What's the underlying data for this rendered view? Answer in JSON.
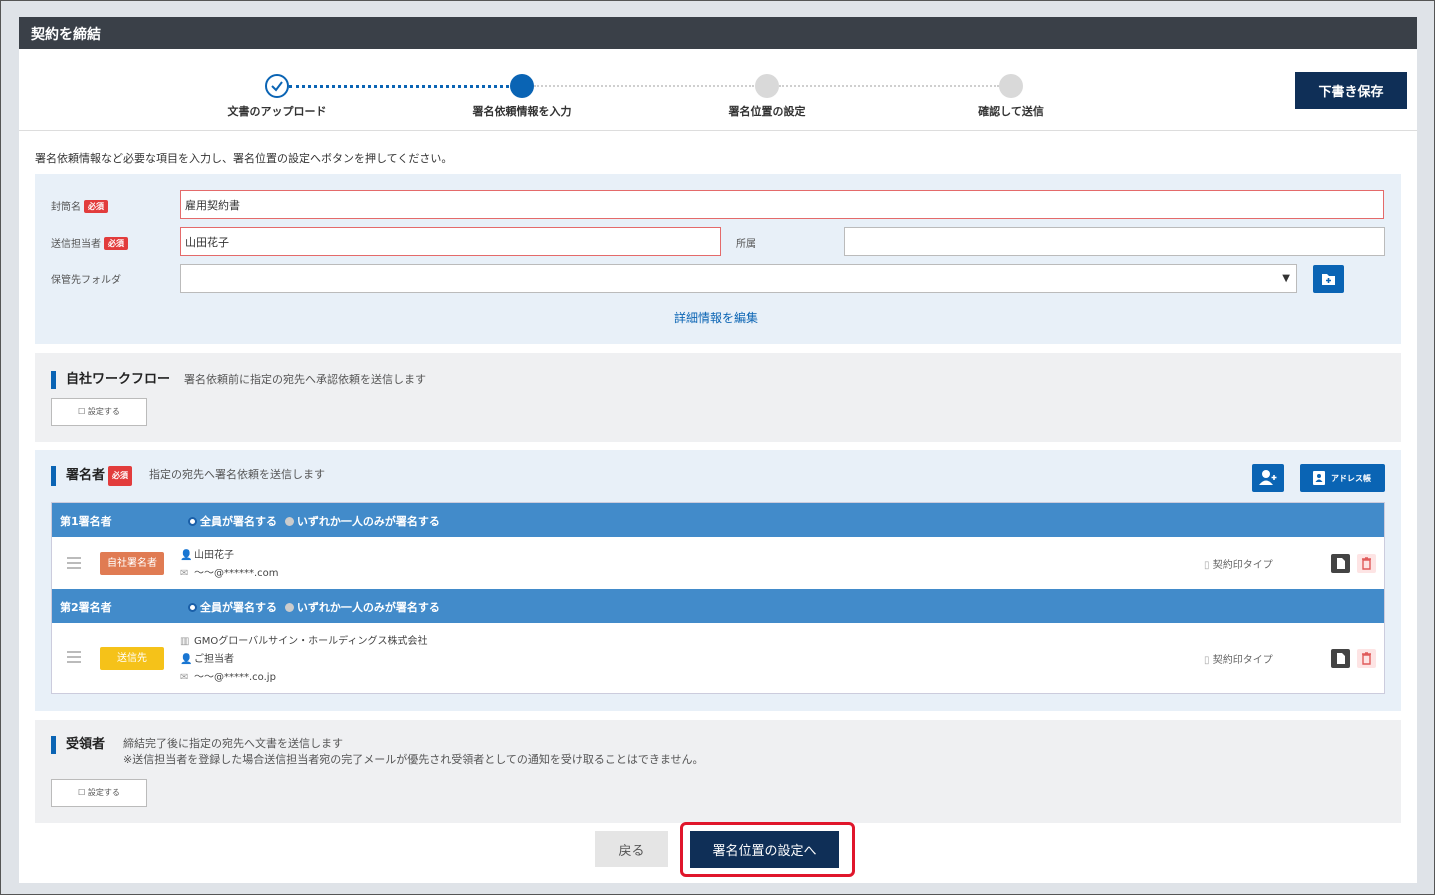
{
  "header": {
    "title": "契約を締結"
  },
  "steps": [
    {
      "label": "文書のアップロード"
    },
    {
      "label": "署名依頼情報を入力"
    },
    {
      "label": "署名位置の設定"
    },
    {
      "label": "確認して送信"
    }
  ],
  "draft_button": "下書き保存",
  "instruction": "署名依頼情報など必要な項目を入力し、署名位置の設定へボタンを押してください。",
  "form": {
    "required_badge": "必須",
    "envelope_label": "封筒名",
    "envelope_value": "雇用契約書",
    "sender_label": "送信担当者",
    "sender_value": "山田花子",
    "dept_label": "所属",
    "dept_value": "",
    "folder_label": "保管先フォルダ",
    "folder_value": "",
    "detail_link": "詳細情報を編集"
  },
  "workflow": {
    "title": "自社ワークフロー",
    "desc": "署名依頼前に指定の宛先へ承認依頼を送信します",
    "setting_button": "☐ 設定する"
  },
  "signers": {
    "title": "署名者",
    "required_badge": "必須",
    "desc": "指定の宛先へ署名依頼を送信します",
    "address_book_button": "アドレス帳",
    "option_all": "全員が署名する",
    "option_one": "いずれか一人のみが署名する",
    "list": [
      {
        "head": "第1署名者",
        "role": "自社署名者",
        "role_color": "#e07b53",
        "company": "",
        "name": "山田花子",
        "email": "〜〜@******.com",
        "type": "契約印タイプ"
      },
      {
        "head": "第2署名者",
        "role": "送信先",
        "role_color": "#f5c219",
        "company": "GMOグローバルサイン・ホールディングス株式会社",
        "name": "ご担当者",
        "email": "〜〜@*****.co.jp",
        "type": "契約印タイプ"
      }
    ]
  },
  "recipients": {
    "title": "受領者",
    "desc1": "締結完了後に指定の宛先へ文書を送信します",
    "desc2": "※送信担当者を登録した場合送信担当者宛の完了メールが優先され受領者としての通知を受け取ることはできません。",
    "setting_button": "☐ 設定する"
  },
  "footer": {
    "back_button": "戻る",
    "next_button": "署名位置の設定へ"
  },
  "colors": {
    "accent": "#0a64b4",
    "dark_button": "#0f2f57",
    "header_bg": "#3a4048",
    "highlight": "#e0162b"
  }
}
